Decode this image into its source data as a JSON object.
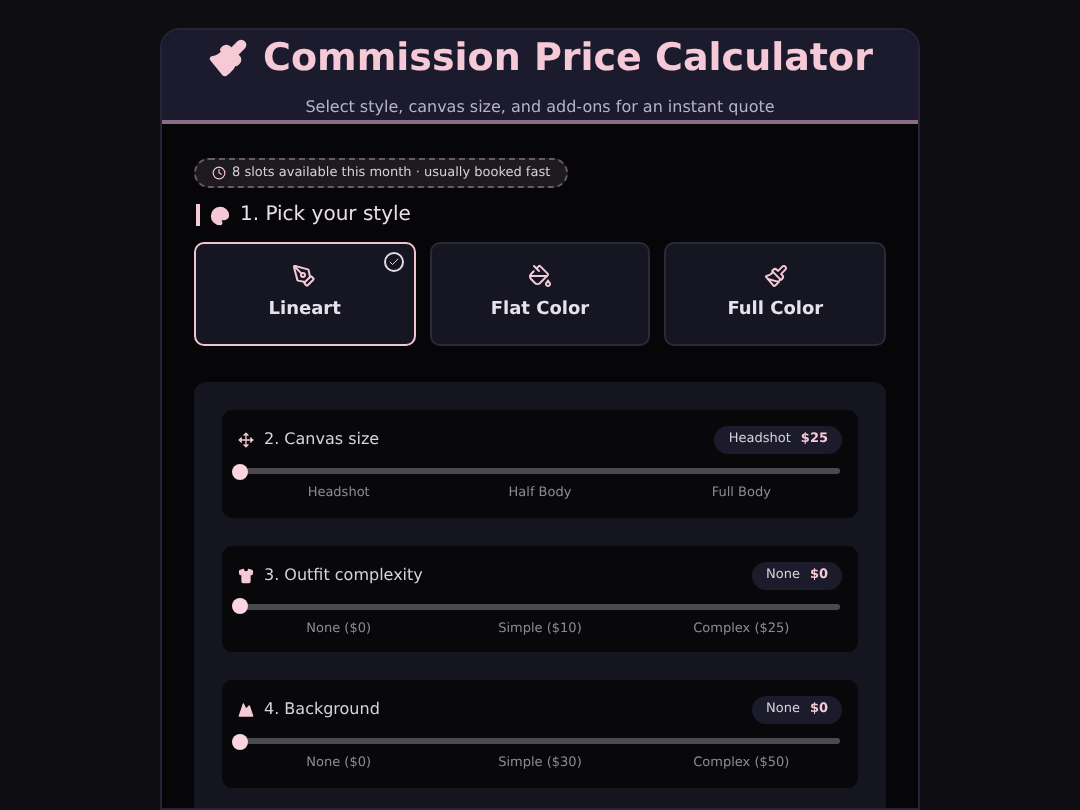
{
  "header": {
    "title": "Commission Price Calculator",
    "subtitle": "Select style, canvas size, and add-ons for an instant quote"
  },
  "availability": "8 slots available this month · usually booked fast",
  "style_section": {
    "heading": "1. Pick your style",
    "options": [
      {
        "label": "Lineart",
        "kind": "pen",
        "selected": true
      },
      {
        "label": "Flat Color",
        "kind": "bucket",
        "selected": false
      },
      {
        "label": "Full Color",
        "kind": "brush",
        "selected": false
      }
    ]
  },
  "sliders": [
    {
      "kind": "move",
      "title": "2. Canvas size",
      "choice": "Headshot",
      "price": "$25",
      "level": 0,
      "ticks": [
        "Headshot",
        "Half Body",
        "Full Body"
      ]
    },
    {
      "kind": "shirt",
      "title": "3. Outfit complexity",
      "choice": "None",
      "price": "$0",
      "level": 0,
      "ticks": [
        "None ($0)",
        "Simple ($10)",
        "Complex ($25)"
      ]
    },
    {
      "kind": "mountain",
      "title": "4. Background",
      "choice": "None",
      "price": "$0",
      "level": 0,
      "ticks": [
        "None ($0)",
        "Simple ($30)",
        "Complex ($50)"
      ]
    }
  ]
}
